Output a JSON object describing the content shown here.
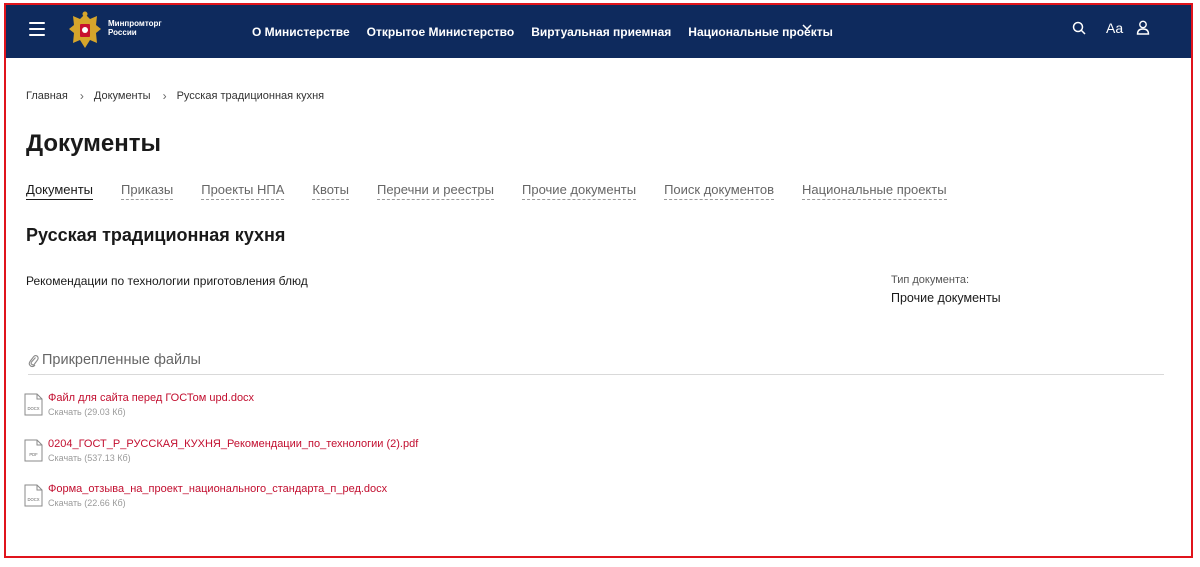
{
  "header": {
    "logo_text_line1": "Минпромторг",
    "logo_text_line2": "России",
    "nav": [
      {
        "label": "О Министерстве"
      },
      {
        "label": "Открытое Министерство"
      },
      {
        "label": "Виртуальная приемная"
      },
      {
        "label": "Национальные проекты"
      }
    ],
    "font_size_label": "Aa",
    "colors": {
      "background": "#0e2a5d",
      "text": "#ffffff"
    }
  },
  "breadcrumb": [
    {
      "label": "Главная"
    },
    {
      "label": "Документы"
    },
    {
      "label": "Русская традиционная кухня"
    }
  ],
  "page_title": "Документы",
  "tabs": [
    {
      "label": "Документы",
      "active": true
    },
    {
      "label": "Приказы",
      "active": false
    },
    {
      "label": "Проекты НПА",
      "active": false
    },
    {
      "label": "Квоты",
      "active": false
    },
    {
      "label": "Перечни и реестры",
      "active": false
    },
    {
      "label": "Прочие документы",
      "active": false
    },
    {
      "label": "Поиск документов",
      "active": false
    },
    {
      "label": "Национальные проекты",
      "active": false
    }
  ],
  "document": {
    "title": "Русская традиционная кухня",
    "description": "Рекомендации по технологии приготовления блюд",
    "type_label": "Тип документа:",
    "type_value": "Прочие документы"
  },
  "attachments": {
    "heading": "Прикрепленные файлы",
    "files": [
      {
        "icon": "docx-file-icon",
        "ext": "DOCX",
        "name": "Файл для сайта перед ГОСТом upd.docx",
        "download": "Скачать (29.03 Кб)"
      },
      {
        "icon": "pdf-file-icon",
        "ext": "PDF",
        "name": "0204_ГОСТ_Р_РУССКАЯ_КУХНЯ_Рекомендации_по_технологии (2).pdf",
        "download": "Скачать (537.13 Кб)"
      },
      {
        "icon": "docx-file-icon",
        "ext": "DOCX",
        "name": "Форма_отзыва_на_проект_национального_стандарта_п_ред.docx",
        "download": "Скачать (22.66 Кб)"
      }
    ]
  },
  "colors": {
    "link": "#c20e2f",
    "highlight_border": "#e0141c"
  }
}
